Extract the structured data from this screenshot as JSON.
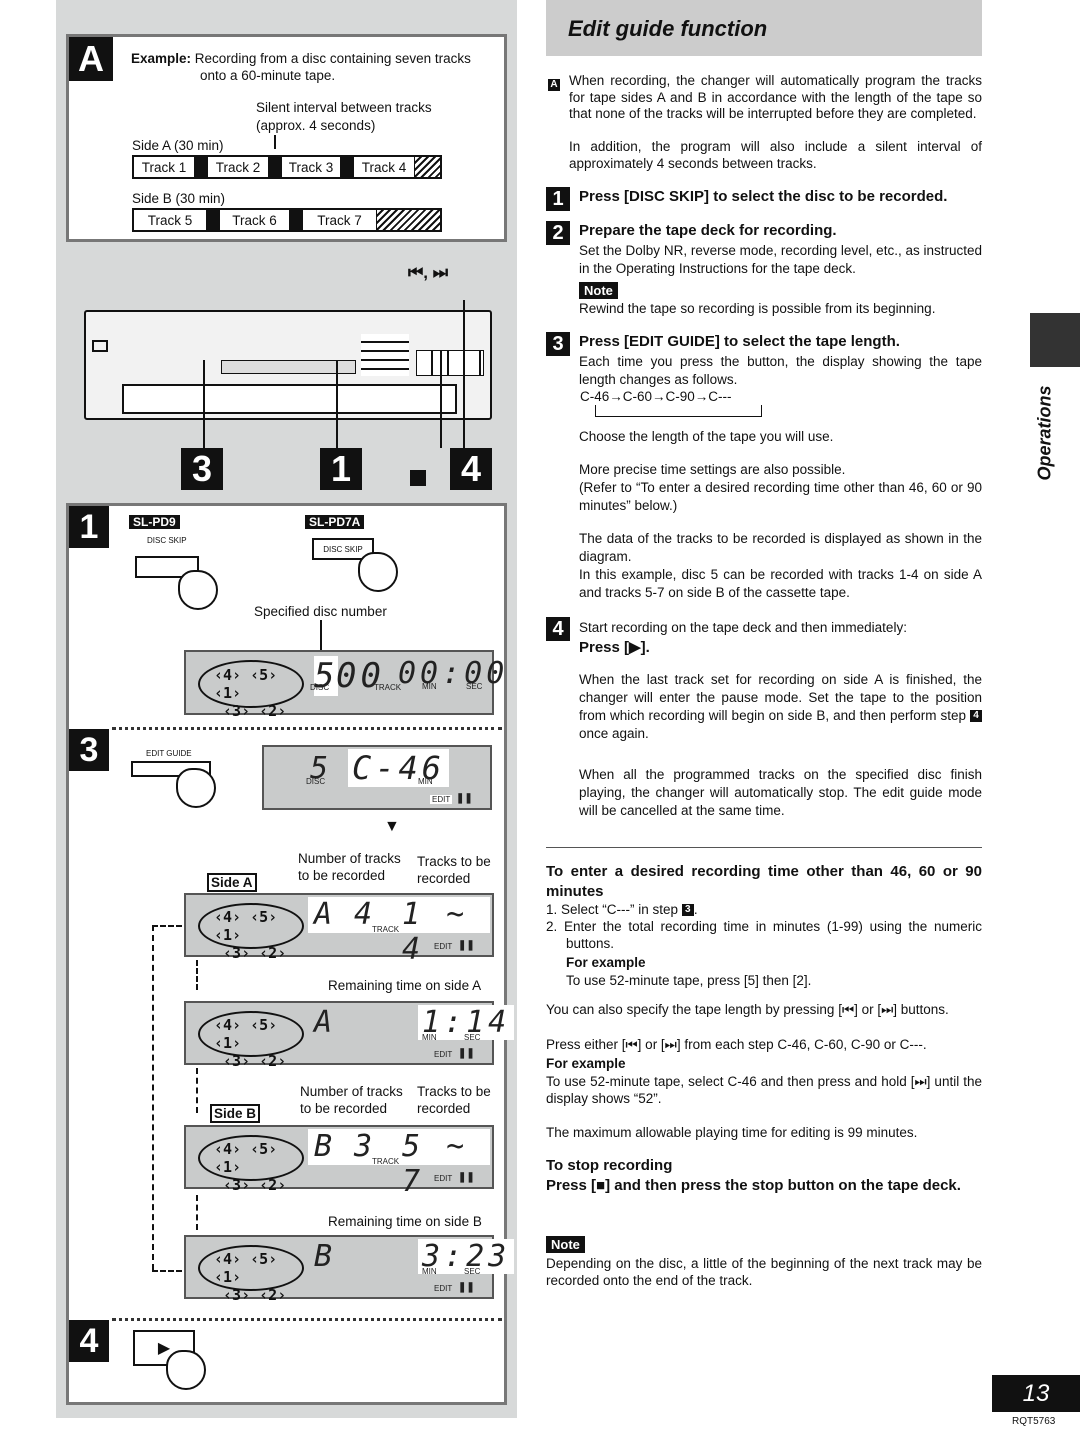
{
  "section_a": {
    "letter": "A",
    "example_label": "Example:",
    "example_text": "Recording from a disc containing seven tracks",
    "example_text2": "onto a 60-minute tape.",
    "silent_interval": "Silent interval between tracks",
    "silent_interval2": "(approx. 4 seconds)",
    "side_a": "Side A (30 min)",
    "side_b": "Side B (30 min)",
    "side_a_tracks": [
      "Track 1",
      "Track 2",
      "Track 3",
      "Track 4"
    ],
    "side_b_tracks": [
      "Track 5",
      "Track 6",
      "Track 7"
    ]
  },
  "device": {
    "skip_label": "⏮, ⏭",
    "callouts": [
      "3",
      "1",
      "■",
      "4"
    ]
  },
  "step1": {
    "num": "1",
    "model_1": "SL-PD9",
    "model_2": "SL-PD7A",
    "button_label": "DISC SKIP",
    "specified": "Specified disc number",
    "display": {
      "disc": "5",
      "track": "00",
      "time": "00:00",
      "disc_label": "DISC",
      "track_label": "TRACK",
      "min_label": "MIN",
      "sec_label": "SEC"
    }
  },
  "step3": {
    "num": "3",
    "button_label": "EDIT GUIDE",
    "display": {
      "disc": "5",
      "tape": "C-46",
      "disc_label": "DISC",
      "min_label": "MIN",
      "edit_label": "EDIT"
    }
  },
  "side_a_block": {
    "side_label": "Side A",
    "num_tracks": "Number of tracks",
    "num_tracks2": "to be recorded",
    "tracks_to": "Tracks to be",
    "tracks_to2": "recorded",
    "display": {
      "side": "A",
      "count": "4",
      "range": "1 ~ 4",
      "track_label": "TRACK",
      "edit_label": "EDIT"
    },
    "remaining": "Remaining time on side A",
    "remaining_display": {
      "side": "A",
      "time": "1:14",
      "min_label": "MIN",
      "sec_label": "SEC",
      "edit_label": "EDIT"
    }
  },
  "side_b_block": {
    "side_label": "Side B",
    "num_tracks": "Number of tracks",
    "num_tracks2": "to be recorded",
    "tracks_to": "Tracks to be",
    "tracks_to2": "recorded",
    "display": {
      "side": "B",
      "count": "3",
      "range": "5 ~ 7",
      "track_label": "TRACK",
      "edit_label": "EDIT"
    },
    "remaining": "Remaining time on side B",
    "remaining_display": {
      "side": "B",
      "time": "3:23",
      "min_label": "MIN",
      "sec_label": "SEC",
      "edit_label": "EDIT"
    }
  },
  "step4": {
    "num": "4",
    "play_icon": "▶"
  },
  "right": {
    "title": "Edit guide function",
    "intro_key": "A",
    "intro": "When recording, the changer will automatically program the tracks for tape sides A and B in accordance with the length of the tape so that none of the tracks will be interrupted before they are completed.",
    "intro2": "In addition, the program will also include a silent interval of approximately 4 seconds between tracks.",
    "steps": [
      {
        "num": "1",
        "heading": "Press [DISC SKIP] to select the disc to be recorded."
      },
      {
        "num": "2",
        "heading": "Prepare the tape deck for recording.",
        "body": "Set the Dolby NR, reverse mode, recording level, etc., as instructed in the Operating Instructions for the tape deck.",
        "note_label": "Note",
        "note": "Rewind the tape so recording is possible from its beginning."
      },
      {
        "num": "3",
        "heading": "Press [EDIT GUIDE] to select the tape length.",
        "body": "Each time you press the button, the display showing the tape length changes as follows.",
        "sequence": [
          "C-46",
          "C-60",
          "C-90",
          "C---"
        ],
        "choose": "Choose the length of the tape you will use.",
        "precise": "More precise time settings are also possible.",
        "refer": "(Refer to “To enter a desired recording time other than 46, 60 or 90 minutes” below.)",
        "data": "The data of the tracks to be recorded is displayed as shown in the diagram.",
        "example": "In this example, disc 5 can be recorded with tracks 1-4 on side A and tracks 5-7 on side B of the cassette tape."
      },
      {
        "num": "4",
        "body": "Start recording on the tape deck and then immediately:",
        "heading": "Press [▶].",
        "para1": "When the last track set for recording on side A is finished, the changer will enter the pause mode. Set the tape to the position from which recording will begin on side B, and then perform step",
        "para1_key": "4",
        "para1_end": "once again.",
        "para2": "When all the programmed tracks on the specified disc finish playing, the changer will automatically stop. The edit guide mode will be cancelled at the same time."
      }
    ],
    "desired": {
      "heading": "To enter a desired recording time other than 46, 60 or 90 minutes",
      "item1": "1.  Select “C---” in step",
      "item1_key": "3",
      "item2": "2.  Enter the total recording time in minutes (1-99) using the numeric buttons.",
      "for_example": "For example",
      "example": "To use 52-minute tape, press [5] then [2].",
      "also": "You can also specify the tape length by pressing [⏮] or [⏭] buttons.",
      "either": "Press either [⏮] or [⏭] from each step C-46, C-60, C-90 or C---.",
      "for_example2": "For example",
      "example2": "To use 52-minute tape, select C-46 and then press and hold [⏭] until the display shows “52”.",
      "max": "The maximum allowable playing time for editing is 99 minutes."
    },
    "stop": {
      "heading": "To stop recording",
      "press": "Press [■] and then press the stop button on the tape deck.",
      "note_label": "Note",
      "note": "Depending on the disc, a little of the beginning of the next track may be recorded onto the end of the track."
    }
  },
  "sidebar": {
    "label": "Operations"
  },
  "footer": {
    "page": "13",
    "code": "RQT5763"
  }
}
